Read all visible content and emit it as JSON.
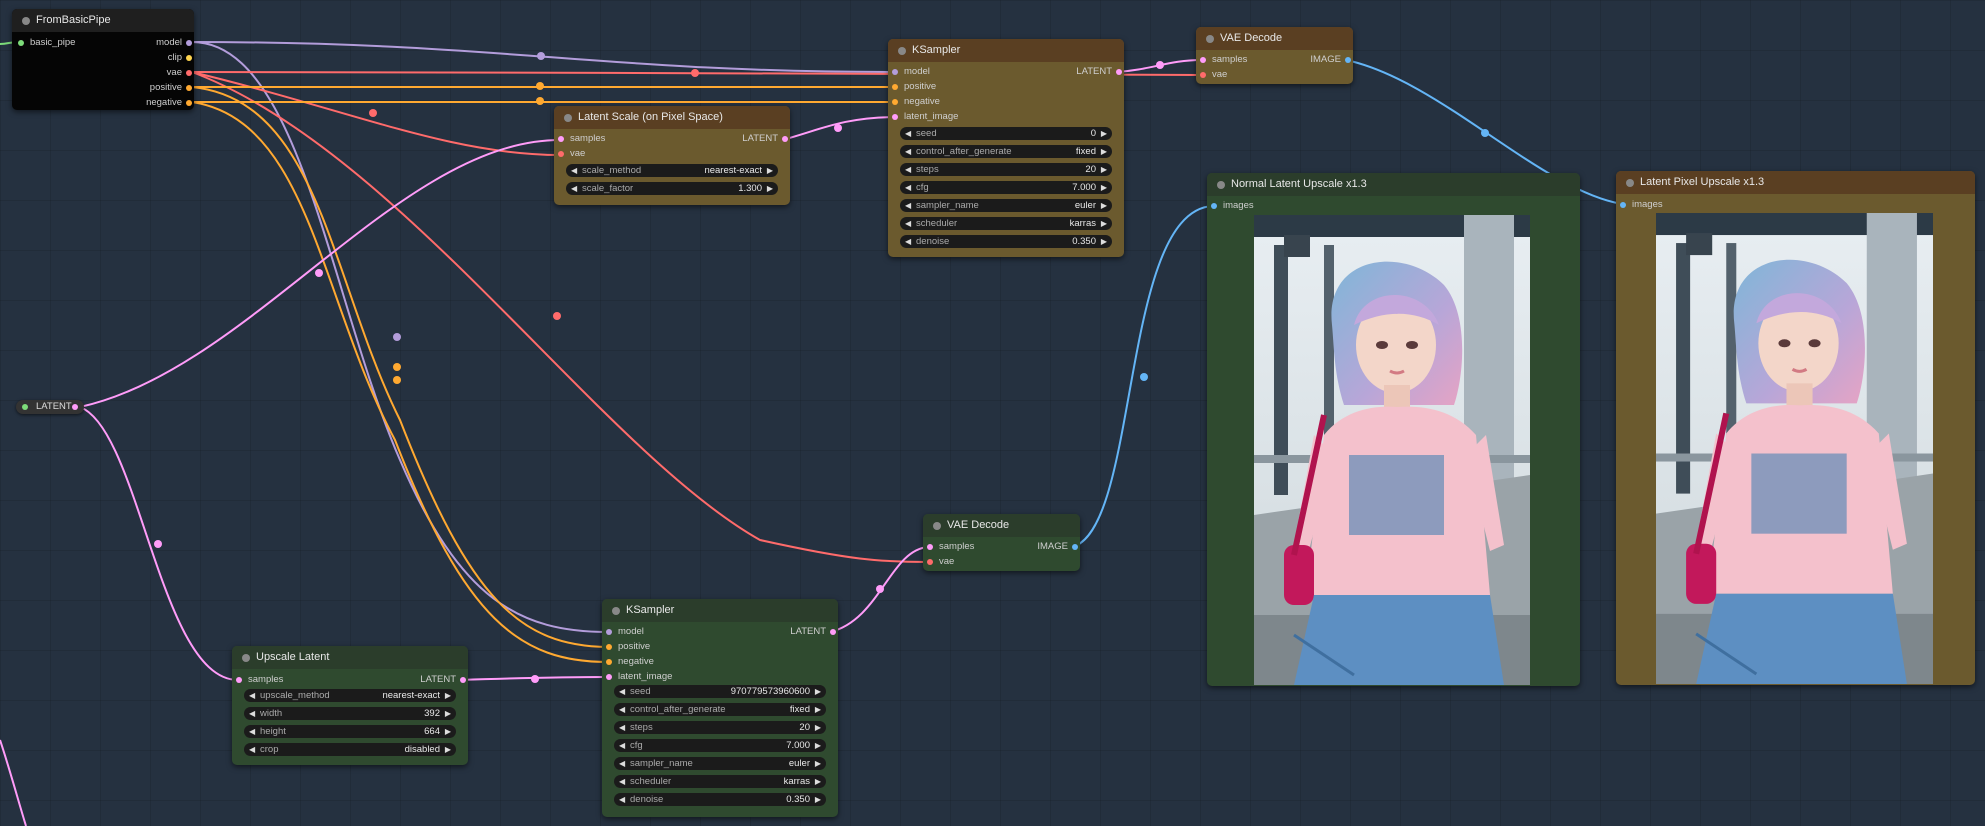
{
  "colors": {
    "model": "#b39ddb",
    "clip": "#ffd54f",
    "vae": "#ff6b6b",
    "conditioning": "#ffa931",
    "latent": "#ff9cf9",
    "image": "#64b5f6",
    "basic_pipe": "#7ddc7a"
  },
  "nodes": {
    "from_basic_pipe": {
      "title": "FromBasicPipe",
      "input": "basic_pipe",
      "outputs": [
        "model",
        "clip",
        "vae",
        "positive",
        "negative"
      ]
    },
    "ksampler_top": {
      "title": "KSampler",
      "inputs": [
        "model",
        "positive",
        "negative",
        "latent_image"
      ],
      "output": "LATENT",
      "widgets": [
        {
          "label": "seed",
          "value": "0"
        },
        {
          "label": "control_after_generate",
          "value": "fixed"
        },
        {
          "label": "steps",
          "value": "20"
        },
        {
          "label": "cfg",
          "value": "7.000"
        },
        {
          "label": "sampler_name",
          "value": "euler"
        },
        {
          "label": "scheduler",
          "value": "karras"
        },
        {
          "label": "denoise",
          "value": "0.350"
        }
      ]
    },
    "vae_decode_top": {
      "title": "VAE Decode",
      "inputs": [
        "samples",
        "vae"
      ],
      "output": "IMAGE"
    },
    "latent_scale": {
      "title": "Latent Scale (on Pixel Space)",
      "inputs": [
        "samples",
        "vae"
      ],
      "output": "LATENT",
      "widgets": [
        {
          "label": "scale_method",
          "value": "nearest-exact"
        },
        {
          "label": "scale_factor",
          "value": "1.300"
        }
      ]
    },
    "normal_upscale": {
      "title": "Normal Latent Upscale x1.3",
      "input": "images"
    },
    "pixel_upscale": {
      "title": "Latent Pixel Upscale x1.3",
      "input": "images"
    },
    "reroute_latent": {
      "label": "LATENT"
    },
    "vae_decode_mid": {
      "title": "VAE Decode",
      "inputs": [
        "samples",
        "vae"
      ],
      "output": "IMAGE"
    },
    "upscale_latent": {
      "title": "Upscale Latent",
      "input": "samples",
      "output": "LATENT",
      "widgets": [
        {
          "label": "upscale_method",
          "value": "nearest-exact"
        },
        {
          "label": "width",
          "value": "392"
        },
        {
          "label": "height",
          "value": "664"
        },
        {
          "label": "crop",
          "value": "disabled"
        }
      ]
    },
    "ksampler_bottom": {
      "title": "KSampler",
      "inputs": [
        "model",
        "positive",
        "negative",
        "latent_image"
      ],
      "output": "LATENT",
      "widgets": [
        {
          "label": "seed",
          "value": "970779573960600"
        },
        {
          "label": "control_after_generate",
          "value": "fixed"
        },
        {
          "label": "steps",
          "value": "20"
        },
        {
          "label": "cfg",
          "value": "7.000"
        },
        {
          "label": "sampler_name",
          "value": "euler"
        },
        {
          "label": "scheduler",
          "value": "karras"
        },
        {
          "label": "denoise",
          "value": "0.350"
        }
      ]
    }
  }
}
